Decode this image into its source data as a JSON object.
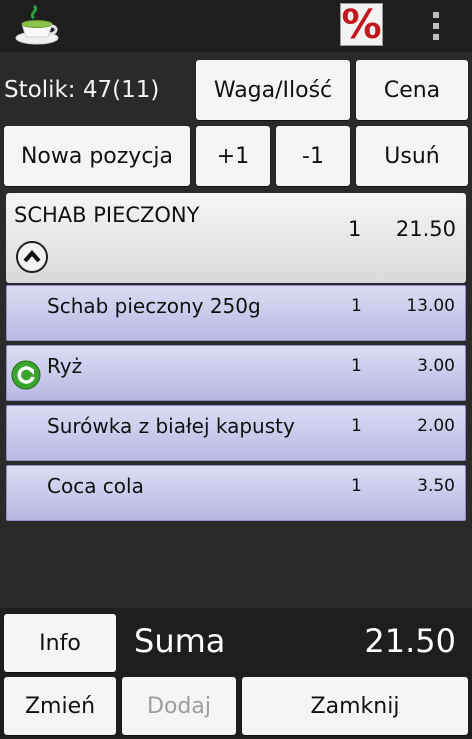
{
  "topbar": {
    "app_icon": "teacup-icon",
    "discount_label": "%",
    "menu_icon": "overflow-menu-icon"
  },
  "order": {
    "table_label": "Stolik: 47(11)",
    "weight_qty_label": "Waga/Ilość",
    "price_label": "Cena",
    "new_item_label": "Nowa pozycja",
    "plus_label": "+1",
    "minus_label": "-1",
    "remove_label": "Usuń"
  },
  "main_item": {
    "name": "SCHAB PIECZONY",
    "qty": "1",
    "price": "21.50"
  },
  "sub_items": [
    {
      "name": "Schab pieczony 250g",
      "qty": "1",
      "price": "13.00"
    },
    {
      "name": "Ryż",
      "qty": "1",
      "price": "3.00"
    },
    {
      "name": "Surówka z białej kapusty",
      "qty": "1",
      "price": "2.00"
    },
    {
      "name": "Coca cola",
      "qty": "1",
      "price": "3.50"
    }
  ],
  "footer": {
    "info_label": "Info",
    "sum_label": "Suma",
    "sum_value": "21.50",
    "change_label": "Zmień",
    "add_label": "Dodaj",
    "close_label": "Zamknij"
  },
  "colors": {
    "accent_red": "#c0181c",
    "item_lavender": "#c8c8ec",
    "refresh_green": "#3aa52c"
  }
}
